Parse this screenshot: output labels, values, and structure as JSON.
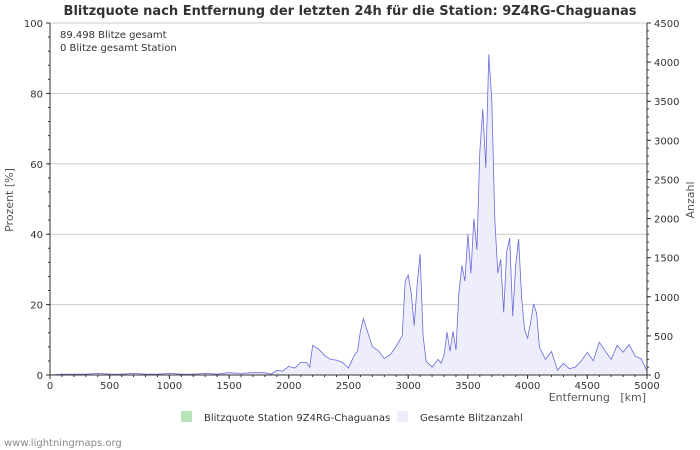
{
  "chart_data": {
    "type": "area",
    "title": "Blitzquote nach Entfernung der letzten 24h für die Station: 9Z4RG-Chaguanas",
    "xlabel": "Entfernung   [km]",
    "ylabel_left": "Prozent   [%]",
    "ylabel_right": "Anzahl",
    "xlim": [
      0,
      5000
    ],
    "ylim_left": [
      0,
      100
    ],
    "ylim_right": [
      0,
      4500
    ],
    "x_ticks": [
      0,
      500,
      1000,
      1500,
      2000,
      2500,
      3000,
      3500,
      4000,
      4500,
      5000
    ],
    "y_ticks_left": [
      0,
      20,
      40,
      60,
      80,
      100
    ],
    "y_ticks_right": [
      0,
      500,
      1000,
      1500,
      2000,
      2500,
      3000,
      3500,
      4000,
      4500
    ],
    "grid": true,
    "annotations": [
      "89.498 Blitze gesamt",
      "0 Blitze gesamt Station"
    ],
    "legend": [
      {
        "label": "Blitzquote Station 9Z4RG-Chaguanas",
        "color": "#b8e2b8"
      },
      {
        "label": "Gesamte Blitzanzahl",
        "color": "#eeeefa"
      }
    ],
    "legend_position": "bottom",
    "series": [
      {
        "name": "Gesamte Blitzanzahl",
        "axis": "right",
        "fill": "#eeeefa",
        "stroke": "#6a6adc",
        "x": [
          0,
          100,
          200,
          300,
          400,
          500,
          600,
          700,
          800,
          900,
          1000,
          1100,
          1200,
          1300,
          1400,
          1500,
          1600,
          1700,
          1800,
          1850,
          1900,
          1950,
          2000,
          2050,
          2100,
          2150,
          2175,
          2200,
          2250,
          2300,
          2350,
          2400,
          2450,
          2500,
          2550,
          2575,
          2600,
          2625,
          2650,
          2700,
          2750,
          2800,
          2850,
          2900,
          2950,
          2975,
          3000,
          3025,
          3050,
          3075,
          3100,
          3125,
          3150,
          3200,
          3250,
          3275,
          3300,
          3325,
          3350,
          3375,
          3400,
          3425,
          3450,
          3475,
          3500,
          3525,
          3550,
          3575,
          3600,
          3625,
          3650,
          3675,
          3700,
          3725,
          3750,
          3775,
          3800,
          3825,
          3850,
          3875,
          3900,
          3925,
          3950,
          3975,
          4000,
          4025,
          4050,
          4075,
          4100,
          4150,
          4200,
          4250,
          4300,
          4350,
          4400,
          4450,
          4500,
          4550,
          4600,
          4650,
          4700,
          4750,
          4800,
          4850,
          4900,
          4950,
          5000
        ],
        "y": [
          0,
          10,
          10,
          10,
          20,
          10,
          10,
          20,
          10,
          10,
          20,
          10,
          10,
          20,
          10,
          30,
          20,
          30,
          30,
          10,
          60,
          50,
          110,
          90,
          160,
          160,
          100,
          380,
          330,
          250,
          200,
          190,
          160,
          90,
          260,
          300,
          560,
          720,
          600,
          360,
          310,
          210,
          260,
          370,
          500,
          1200,
          1280,
          1050,
          630,
          1160,
          1550,
          500,
          180,
          100,
          200,
          150,
          250,
          550,
          300,
          560,
          320,
          1050,
          1400,
          1200,
          1800,
          1300,
          2000,
          1600,
          2850,
          3400,
          2650,
          4100,
          3500,
          2000,
          1300,
          1480,
          800,
          1580,
          1750,
          750,
          1400,
          1740,
          1000,
          580,
          470,
          670,
          910,
          790,
          350,
          200,
          300,
          60,
          150,
          80,
          100,
          180,
          290,
          180,
          420,
          310,
          200,
          380,
          290,
          390,
          240,
          210,
          50
        ]
      },
      {
        "name": "Blitzquote Station 9Z4RG-Chaguanas",
        "axis": "left",
        "fill": "#b8e2b8",
        "stroke": "#4caf4c",
        "x": [
          0,
          5000
        ],
        "y": [
          0,
          0
        ]
      }
    ]
  },
  "footer": {
    "text": "www.lightningmaps.org"
  }
}
